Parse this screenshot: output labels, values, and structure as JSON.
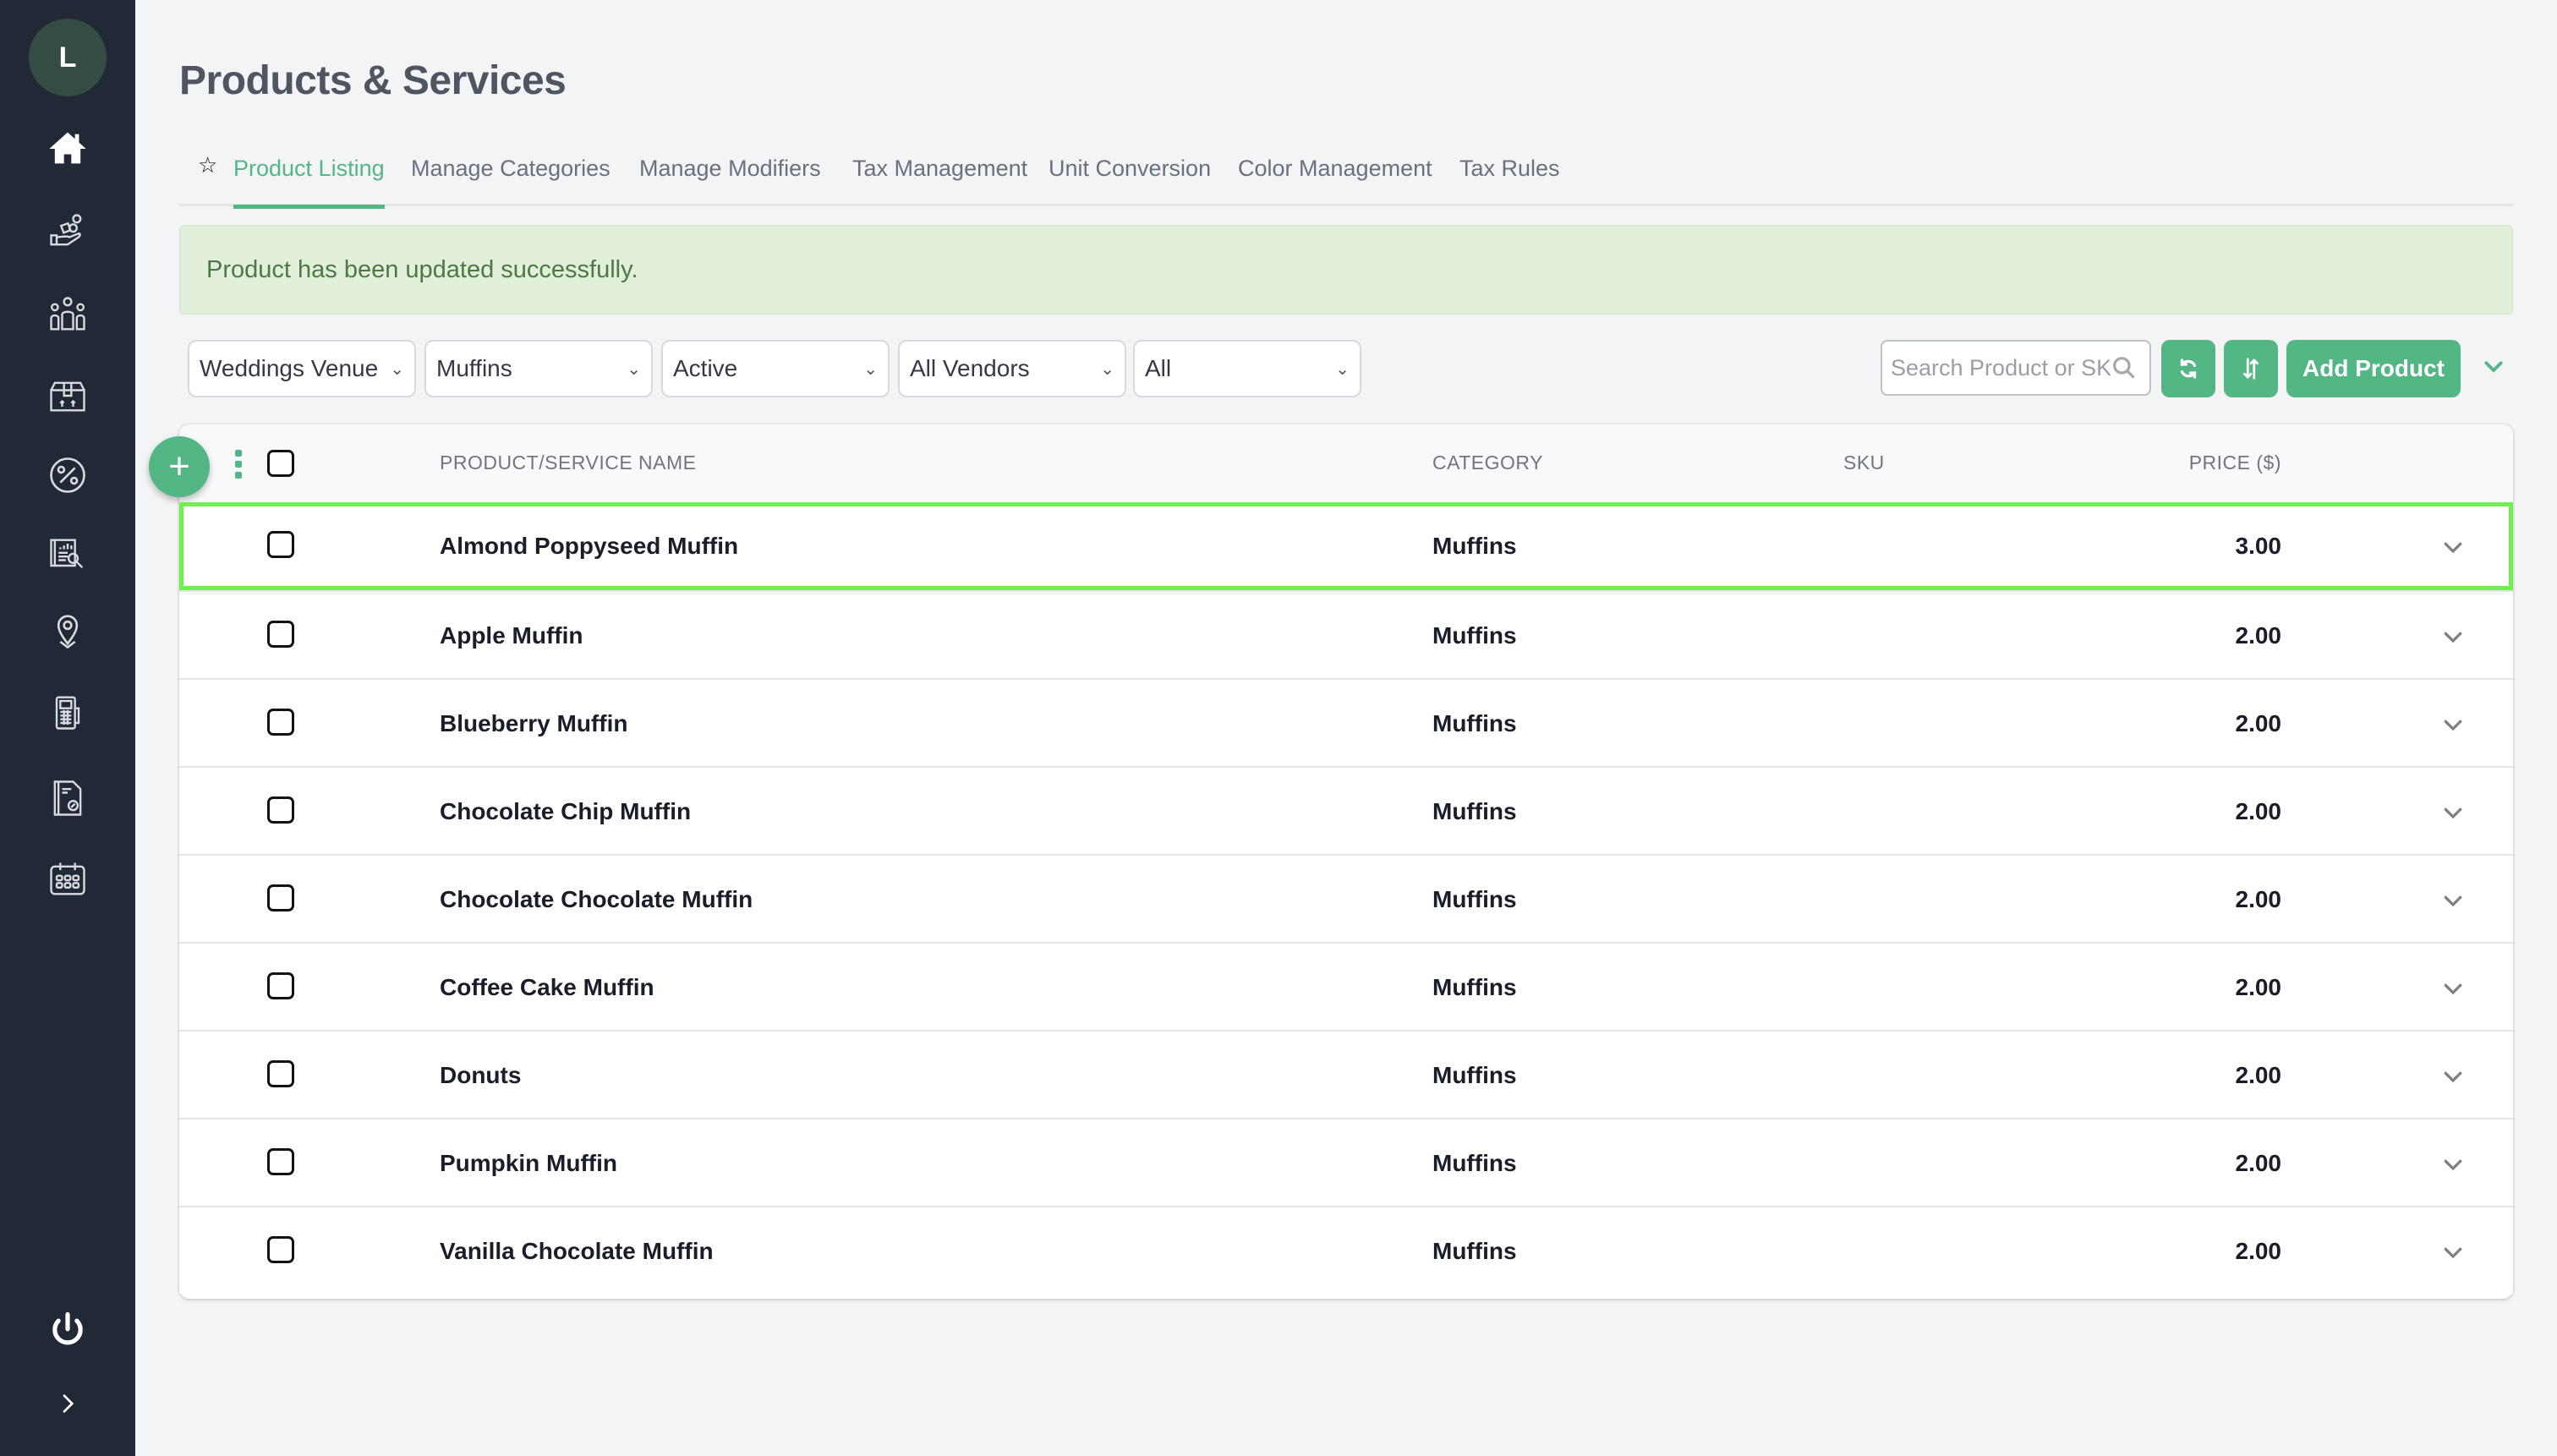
{
  "sidebar": {
    "avatar_initial": "L",
    "items": [
      {
        "name": "home",
        "icon": "home-icon"
      },
      {
        "name": "products",
        "icon": "hand-boxes-icon"
      },
      {
        "name": "team",
        "icon": "people-group-icon"
      },
      {
        "name": "inventory",
        "icon": "box-store-icon"
      },
      {
        "name": "discounts",
        "icon": "percent-badge-icon"
      },
      {
        "name": "reports",
        "icon": "report-search-icon"
      },
      {
        "name": "locations",
        "icon": "location-pin-icon"
      },
      {
        "name": "terminal",
        "icon": "pos-terminal-icon"
      },
      {
        "name": "invoices",
        "icon": "document-check-icon"
      },
      {
        "name": "calendar",
        "icon": "calendar-icon"
      }
    ],
    "logout_icon": "power-icon",
    "expand_icon": "chevron-right-icon"
  },
  "header": {
    "title": "Products & Services"
  },
  "tabs": [
    {
      "label": "Product Listing",
      "active": true
    },
    {
      "label": "Manage Categories",
      "active": false
    },
    {
      "label": "Manage Modifiers",
      "active": false
    },
    {
      "label": "Tax Management",
      "active": false
    },
    {
      "label": "Unit Conversion",
      "active": false
    },
    {
      "label": "Color Management",
      "active": false
    },
    {
      "label": "Tax Rules",
      "active": false
    }
  ],
  "alert": {
    "message": "Product has been updated successfully."
  },
  "filters": {
    "venue": "Weddings Venue",
    "category": "Muffins",
    "status": "Active",
    "vendor": "All Vendors",
    "type": "All"
  },
  "toolbar": {
    "search_placeholder": "Search Product or SKU",
    "refresh_icon": "refresh-icon",
    "sort_icon": "sort-icon",
    "add_label": "Add Product"
  },
  "colors": {
    "accent": "#53b685",
    "sidebar_bg": "#212836",
    "highlight_border": "#6ff04e",
    "alert_bg": "#e1efdb",
    "alert_text": "#4c7a42"
  },
  "table": {
    "columns": [
      "PRODUCT/SERVICE NAME",
      "CATEGORY",
      "SKU",
      "PRICE ($)"
    ],
    "rows": [
      {
        "name": "Almond Poppyseed Muffin",
        "category": "Muffins",
        "sku": "",
        "price": "3.00",
        "highlighted": true
      },
      {
        "name": "Apple Muffin",
        "category": "Muffins",
        "sku": "",
        "price": "2.00"
      },
      {
        "name": "Blueberry Muffin",
        "category": "Muffins",
        "sku": "",
        "price": "2.00"
      },
      {
        "name": "Chocolate Chip Muffin",
        "category": "Muffins",
        "sku": "",
        "price": "2.00"
      },
      {
        "name": "Chocolate Chocolate Muffin",
        "category": "Muffins",
        "sku": "",
        "price": "2.00"
      },
      {
        "name": "Coffee Cake Muffin",
        "category": "Muffins",
        "sku": "",
        "price": "2.00"
      },
      {
        "name": "Donuts",
        "category": "Muffins",
        "sku": "",
        "price": "2.00"
      },
      {
        "name": "Pumpkin Muffin",
        "category": "Muffins",
        "sku": "",
        "price": "2.00"
      },
      {
        "name": "Vanilla Chocolate Muffin",
        "category": "Muffins",
        "sku": "",
        "price": "2.00"
      }
    ]
  }
}
